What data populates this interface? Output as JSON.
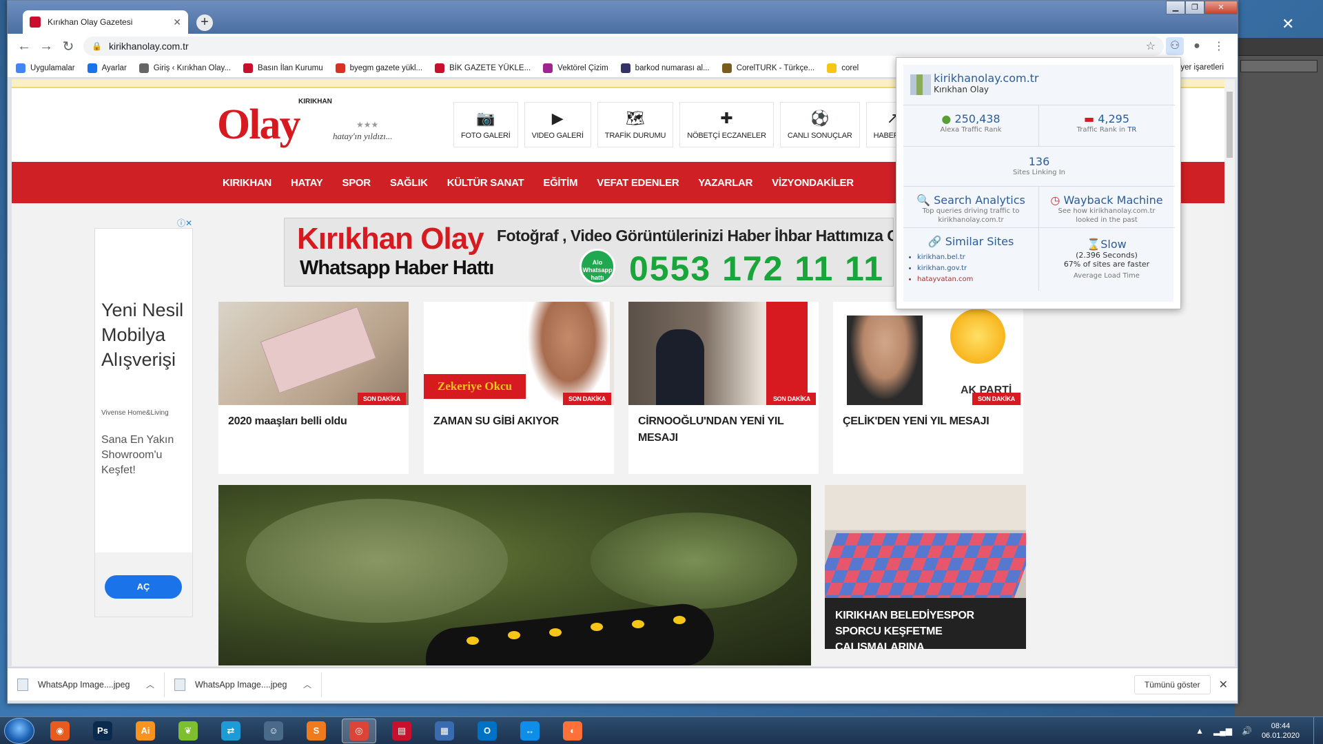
{
  "browser": {
    "tab_title": "Kırıkhan Olay Gazetesi",
    "url": "kirikhanolay.com.tr",
    "bookmarks": [
      {
        "label": "Uygulamalar",
        "color": "#4285f4"
      },
      {
        "label": "Ayarlar",
        "color": "#1a73e8"
      },
      {
        "label": "Giriş ‹ Kırıkhan Olay...",
        "color": "#666666"
      },
      {
        "label": "Basın İlan Kurumu",
        "color": "#c8102e"
      },
      {
        "label": "byegm gazete yükl...",
        "color": "#d93025"
      },
      {
        "label": "BİK GAZETE YÜKLE...",
        "color": "#c8102e"
      },
      {
        "label": "Vektörel Çizim",
        "color": "#a0248f"
      },
      {
        "label": "barkod numarası al...",
        "color": "#333366"
      },
      {
        "label": "CorelTURK - Türkçe...",
        "color": "#7a5c1e"
      },
      {
        "label": "corel",
        "color": "#f5c518"
      }
    ],
    "bookmarks_more": "r yer işaretleri"
  },
  "site": {
    "logo": "Olay",
    "logo_small": "KIRIKHAN",
    "slogan": "hatay'ın yıldızı...",
    "tools": [
      {
        "icon": "camera-icon",
        "glyph": "📷",
        "label": "FOTO GALERİ"
      },
      {
        "icon": "play-icon",
        "glyph": "▶",
        "label": "VIDEO GALERİ"
      },
      {
        "icon": "map-icon",
        "glyph": "🗺",
        "label": "TRAFİK DURUMU"
      },
      {
        "icon": "pharmacy-icon",
        "glyph": "✚",
        "label": "NÖBETÇİ ECZANELER"
      },
      {
        "icon": "football-icon",
        "glyph": "⚽",
        "label": "CANLI SONUÇLAR"
      },
      {
        "icon": "share-icon",
        "glyph": "↗",
        "label": "HABER GÖ"
      }
    ],
    "menu": [
      "KIRIKHAN",
      "HATAY",
      "SPOR",
      "SAĞLIK",
      "KÜLTÜR SANAT",
      "EĞİTİM",
      "VEFAT EDENLER",
      "YAZARLAR",
      "VİZYONDAKİLER"
    ],
    "ad": {
      "title": "Yeni Nesil Mobilya Alışverişi",
      "brand": "Vivense Home&Living",
      "desc": "Sana En Yakın Showroom'u Keşfet!",
      "button": "AÇ"
    },
    "banner": {
      "line1": "Kırıkhan Olay",
      "line2": "Whatsapp Haber Hattı",
      "line3": "Fotoğraf , Video Görüntülerinizi  Haber İhbar Hattımıza Gönderebi",
      "badge": "Alo Whatsapp hattı",
      "phone": "0553 172 11 11"
    },
    "badge_label": "SON DAKİKA",
    "cards": [
      {
        "title": "2020 maaşları belli oldu"
      },
      {
        "title": "ZAMAN SU GİBİ AKIYOR",
        "overlay": "Zekeriye Okcu"
      },
      {
        "title": "CİRNOOĞLU'NDAN YENİ YIL MESAJI"
      },
      {
        "title": "ÇELİK'DEN YENİ YIL MESAJI",
        "overlay": "AK PARTİ"
      }
    ],
    "side_news": "KIRIKHAN BELEDİYESPOR SPORCU KEŞFETME ÇALIŞMALARINA"
  },
  "alexa": {
    "domain": "kirikhanolay.com.tr",
    "name": "Kırıkhan Olay",
    "global_rank": "250,438",
    "global_rank_label": "Alexa Traffic Rank",
    "country_rank": "4,295",
    "country_rank_label": "Traffic Rank in",
    "country_code": "TR",
    "sites_linking": "136",
    "sites_linking_label": "Sites Linking In",
    "search_title": "Search Analytics",
    "search_desc": "Top queries driving traffic to kirikhanolay.com.tr",
    "wayback_title": "Wayback Machine",
    "wayback_desc": "See how kirikhanolay.com.tr looked in the past",
    "similar_title": "Similar Sites",
    "similar_sites": [
      "kirikhan.bel.tr",
      "kirikhan.gov.tr",
      "hatayvatan.com"
    ],
    "speed_title": "Slow",
    "speed_seconds": "(2.396 Seconds)",
    "speed_pct": "67% of sites are faster",
    "speed_label": "Average Load Time"
  },
  "downloads": {
    "items": [
      "WhatsApp Image....jpeg",
      "WhatsApp Image....jpeg"
    ],
    "show_all": "Tümünü göster"
  },
  "taskbar": {
    "apps": [
      {
        "icon": "media-player-icon",
        "glyph": "◉",
        "color": "#e85a1e"
      },
      {
        "icon": "photoshop-icon",
        "glyph": "Ps",
        "color": "#0b2b4e"
      },
      {
        "icon": "illustrator-icon",
        "glyph": "Ai",
        "color": "#f7931e"
      },
      {
        "icon": "corel-icon",
        "glyph": "❦",
        "color": "#7ebf2f"
      },
      {
        "icon": "teamviewer-icon",
        "glyph": "⇄",
        "color": "#1e9bd7"
      },
      {
        "icon": "user-tool-icon",
        "glyph": "☺",
        "color": "#4a6a8a"
      },
      {
        "icon": "sublime-icon",
        "glyph": "S",
        "color": "#f07a1e"
      },
      {
        "icon": "chrome-icon",
        "glyph": "◎",
        "color": "#db4437"
      },
      {
        "icon": "pdf-icon",
        "glyph": "▤",
        "color": "#c8102e"
      },
      {
        "icon": "network-icon",
        "glyph": "▦",
        "color": "#3a6ab0"
      },
      {
        "icon": "outlook-icon",
        "glyph": "O",
        "color": "#0072c6"
      },
      {
        "icon": "teamviewer2-icon",
        "glyph": "↔",
        "color": "#0e8ee9"
      },
      {
        "icon": "firefox-icon",
        "glyph": "◐",
        "color": "#ff7139"
      }
    ],
    "time": "08:44",
    "date": "06.01.2020"
  }
}
